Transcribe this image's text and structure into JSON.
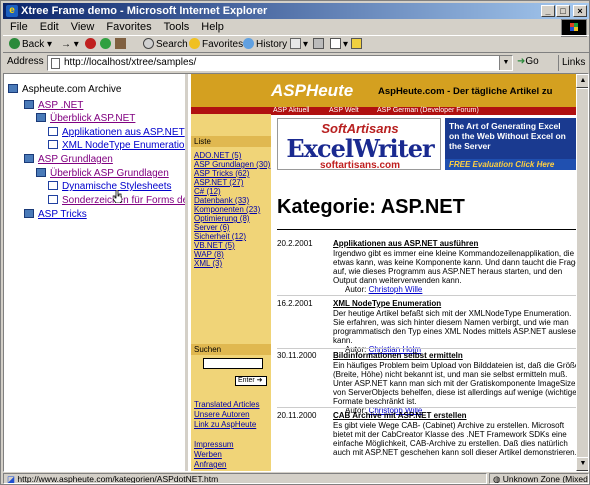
{
  "window": {
    "title": "Xtree Frame demo - Microsoft Internet Explorer",
    "buttons": {
      "minimize": "_",
      "maximize": "□",
      "close": "×"
    }
  },
  "menubar": [
    "File",
    "Edit",
    "View",
    "Favorites",
    "Tools",
    "Help"
  ],
  "toolbar": {
    "back": "Back",
    "search": "Search",
    "favorites": "Favorites",
    "history": "History"
  },
  "addressbar": {
    "label": "Address",
    "url": "http://localhost/xtree/samples/",
    "go": "Go",
    "links": "Links"
  },
  "tree": {
    "root": "Aspheute.com Archive",
    "items": [
      {
        "label": "ASP .NET",
        "level": 1,
        "icon": "book-icon",
        "visited": true
      },
      {
        "label": "Überblick ASP.NET",
        "level": 2,
        "icon": "book-icon",
        "visited": true
      },
      {
        "label": "Applikationen aus ASP.NET",
        "level": 3,
        "icon": "page-icon",
        "visited": false
      },
      {
        "label": "XML NodeType Enumeration",
        "level": 3,
        "icon": "page-icon",
        "visited": false
      },
      {
        "label": "ASP Grundlagen",
        "level": 1,
        "icon": "book-icon",
        "visited": true
      },
      {
        "label": "Überblick ASP Grundlagen",
        "level": 2,
        "icon": "book-icon",
        "visited": true
      },
      {
        "label": "Dynamische Stylesheets",
        "level": 3,
        "icon": "page-icon",
        "visited": false
      },
      {
        "label": "Sonderzeichen für Forms de",
        "level": 3,
        "icon": "page-icon",
        "visited": false
      },
      {
        "label": "ASP Tricks",
        "level": 1,
        "icon": "book-icon",
        "visited": false
      }
    ]
  },
  "site": {
    "logo": "ASPHeute",
    "tagline": "AspHeute.com - Der tägliche Artikel zu",
    "nav": [
      "ASP Aktuell",
      "ASP Welt",
      "ASP German (Developer Forum)"
    ],
    "liste_title": "Liste",
    "liste": [
      "ADO.NET (5)",
      "ASP Grundlagen (30)",
      "ASP Tricks (62)",
      "ASP.NET (27)",
      "C# (12)",
      "Datenbank (33)",
      "Komponenten (23)",
      "Optimierung (8)",
      "Server (6)",
      "Sicherheit (12)",
      "VB.NET (5)",
      "WAP (8)",
      "XML (3)"
    ],
    "suchen_title": "Suchen",
    "enter_label": "Enter",
    "extra_links": [
      "Translated Articles",
      "Unsere Autoren",
      "Link zu AspHeute"
    ],
    "footer_links": [
      "Impressum",
      "Werben",
      "Anfragen"
    ],
    "ad": {
      "brand_top": "SoftArtisans",
      "brand_main": "ExcelWriter",
      "brand_url": "softartisans.com",
      "pitch": "The Art of Generating Excel on the Web Without Excel on the Server",
      "cta": "FREE Evaluation Click Here"
    },
    "heading": "Kategorie: ASP.NET",
    "articles": [
      {
        "date": "20.2.2001",
        "title": "Applikationen aus ASP.NET ausführen",
        "desc": "Irgendwo gibt es immer eine kleine Kommandozeilenapplikation, die etwas kann, was keine Komponente kann. Und dann taucht die Frage auf, wie dieses Programm aus ASP.NET heraus starten, und den Output dann weiterverwenden kann.",
        "author_label": "Autor:",
        "author": "Christoph Wille"
      },
      {
        "date": "16.2.2001",
        "title": "XML NodeType Enumeration",
        "desc": "Der heutige Artikel befaßt sich mit der XMLNodeType Enumeration. Sie erfahren, was sich hinter diesem Namen verbirgt, und wie man programmatisch den Typ eines XML Nodes mittels ASP.NET auslesen kann.",
        "author_label": "Autor:",
        "author": "Christian Holm"
      },
      {
        "date": "30.11.2000",
        "title": "Bildinformationen selbst ermitteln",
        "desc": "Ein häufiges Problem beim Upload von Bilddateien ist, daß die Größe (Breite, Höhe) nicht bekannt ist, und man sie selbst ermitteln muß. Unter ASP.NET kann man sich mit der Gratiskomponente ImageSize von ServerObjects behelfen, diese ist allerdings auf wenige (wichtige) Formate beschränkt ist.",
        "author_label": "Autor:",
        "author": "Christoph Wille"
      },
      {
        "date": "20.11.2000",
        "title": "CAB Archive mit ASP.NET erstellen",
        "desc": "Es gibt viele Wege CAB- (Cabinet) Archive zu erstellen. Microsoft bietet mit der CabCreator Klasse des .NET Framework SDKs eine einfache Möglichkeit, CAB-Archive zu erstellen. Daß dies natürlich auch mit ASP.NET geschehen kann soll dieser Artikel demonstrieren.",
        "author_label": "",
        "author": ""
      }
    ]
  },
  "status": {
    "text": "http://www.aspheute.com/kategorien/ASPdotNET.htm",
    "zone": "Unknown Zone (Mixed)"
  },
  "colors": {
    "title_bar": "#0a246a",
    "banner": "#d4a020",
    "nav_strip": "#b01010",
    "sidebar": "#f0d478",
    "link": "#0000cc",
    "visited_link": "#800080"
  }
}
